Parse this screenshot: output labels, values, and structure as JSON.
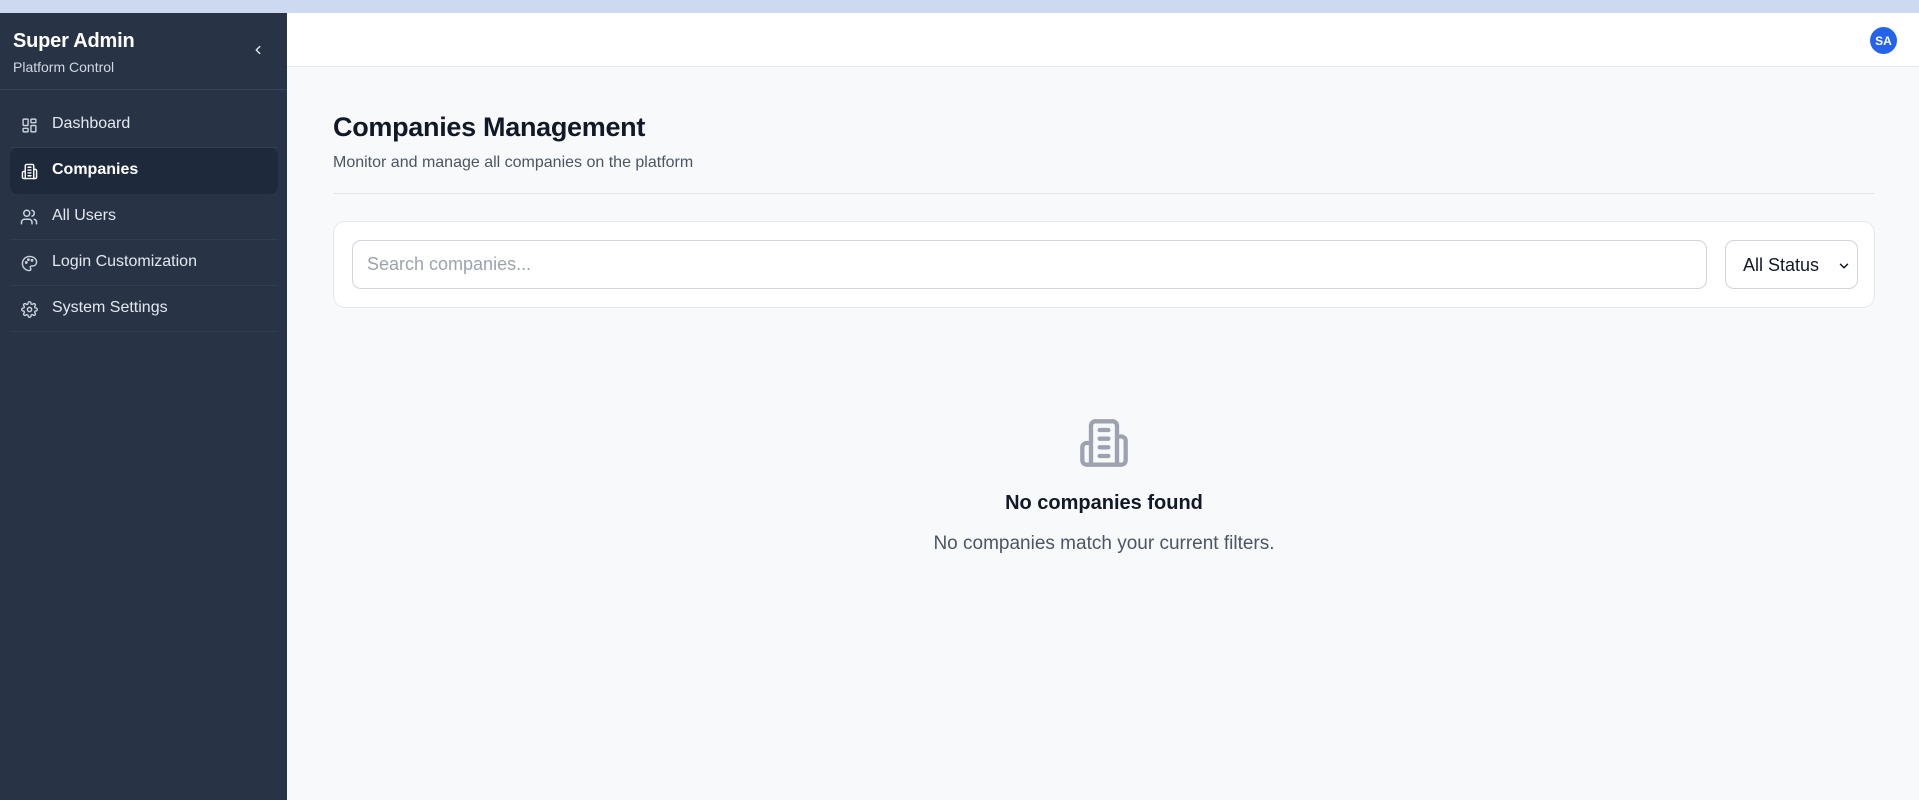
{
  "sidebar": {
    "title": "Super Admin",
    "subtitle": "Platform Control",
    "collapse_icon": "chevron-left-icon",
    "items": [
      {
        "label": "Dashboard",
        "icon": "dashboard-icon",
        "active": false
      },
      {
        "label": "Companies",
        "icon": "building-icon",
        "active": true
      },
      {
        "label": "All Users",
        "icon": "users-icon",
        "active": false
      },
      {
        "label": "Login Customization",
        "icon": "palette-icon",
        "active": false
      },
      {
        "label": "System Settings",
        "icon": "gear-icon",
        "active": false
      }
    ]
  },
  "header": {
    "avatar_initials": "SA"
  },
  "main": {
    "title": "Companies Management",
    "subtitle": "Monitor and manage all companies on the platform",
    "search": {
      "placeholder": "Search companies...",
      "value": ""
    },
    "status_filter": {
      "selected": "All Status"
    },
    "empty_state": {
      "icon": "building-icon",
      "title": "No companies found",
      "message": "No companies match your current filters."
    }
  },
  "colors": {
    "sidebar_bg": "#283446",
    "sidebar_active_bg": "#1e2a3b",
    "accent": "#2563eb",
    "page_bg": "#f8f9fb",
    "top_strip": "#cdd9f1"
  }
}
